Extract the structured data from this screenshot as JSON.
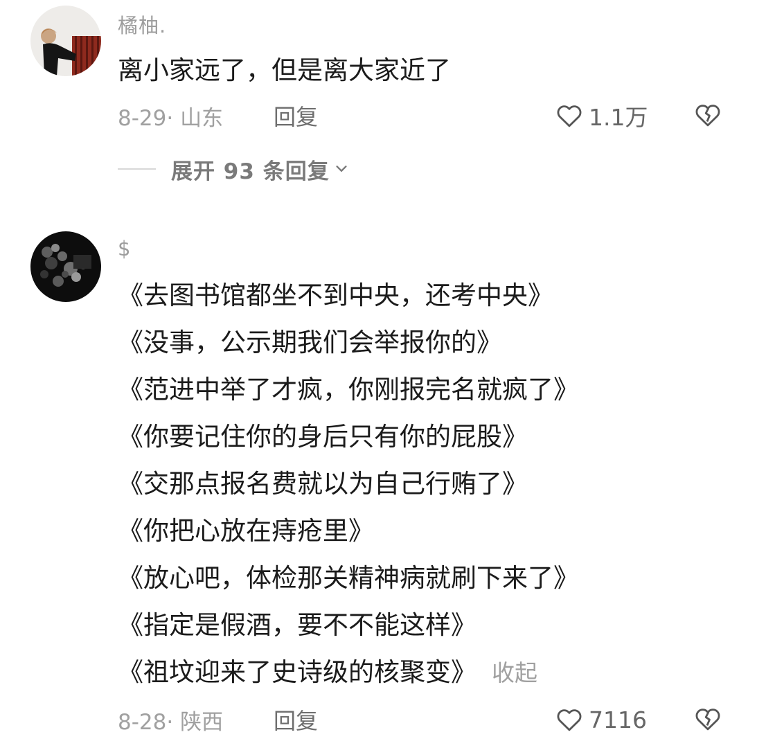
{
  "comments": [
    {
      "username": "橘柚.",
      "lines": [
        "离小家远了，但是离大家近了"
      ],
      "date_location": "8-29· 山东",
      "reply_label": "回复",
      "likes": "1.1万",
      "expand_label": "展开 93 条回复"
    },
    {
      "username": "$",
      "lines": [
        "《去图书馆都坐不到中央，还考中央》",
        "《没事，公示期我们会举报你的》",
        "《范进中举了才疯，你刚报完名就疯了》",
        "《你要记住你的身后只有你的屁股》",
        "《交那点报名费就以为自己行贿了》",
        "《你把心放在痔疮里》",
        "《放心吧，体检那关精神病就刷下来了》",
        "《指定是假酒，要不不能这样》",
        "《祖坟迎来了史诗级的核聚变》"
      ],
      "collapse_label": "收起",
      "date_location": "8-28· 陕西",
      "reply_label": "回复",
      "likes": "7116"
    }
  ],
  "icons": {
    "like": "heart-outline-icon",
    "dislike": "broken-heart-icon",
    "expand": "chevron-down-icon"
  }
}
